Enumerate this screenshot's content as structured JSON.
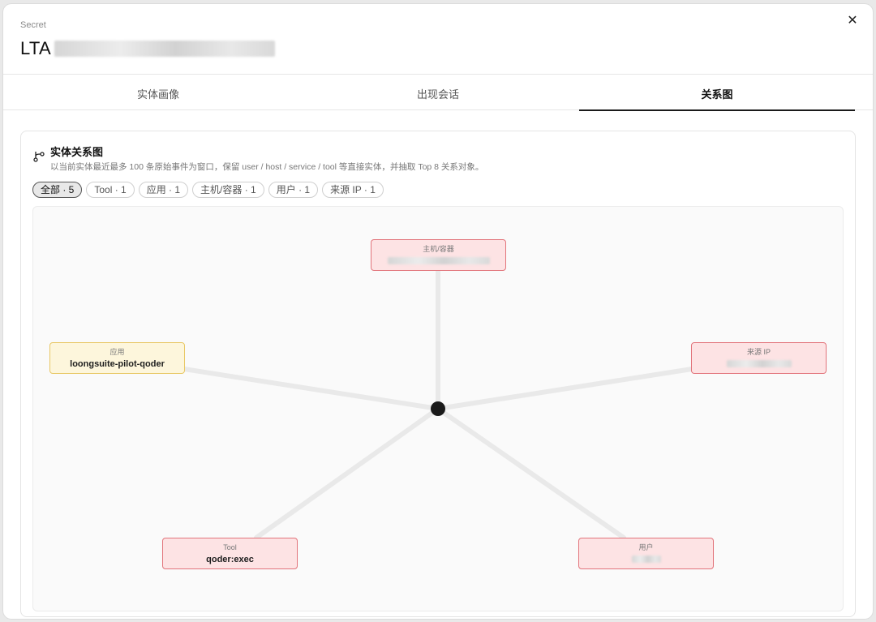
{
  "header": {
    "kicker": "Secret",
    "title_prefix": "LTA",
    "close_symbol": "✕"
  },
  "tabs": [
    {
      "label": "实体画像"
    },
    {
      "label": "出现会话"
    },
    {
      "label": "关系图"
    }
  ],
  "card": {
    "title": "实体关系图",
    "description": "以当前实体最近最多 100 条原始事件为窗口，保留 user / host / service / tool 等直接实体，并抽取 Top 8 关系对象。"
  },
  "filters": [
    {
      "label": "全部 · 5"
    },
    {
      "label": "Tool · 1"
    },
    {
      "label": "应用 · 1"
    },
    {
      "label": "主机/容器 · 1"
    },
    {
      "label": "用户 · 1"
    },
    {
      "label": "来源 IP · 1"
    }
  ],
  "nodes": {
    "host": {
      "type": "主机/容器"
    },
    "app": {
      "type": "应用",
      "label": "loongsuite-pilot-qoder"
    },
    "ip": {
      "type": "来源 IP"
    },
    "tool": {
      "type": "Tool",
      "label": "qoder:exec"
    },
    "user": {
      "type": "用户"
    }
  },
  "colors": {
    "edge": "#e9e9e9",
    "center": "#1a1a1a",
    "node_red_fill": "#fde3e4",
    "node_red_border": "#e2747b",
    "node_yellow_fill": "#fdf6dc",
    "node_yellow_border": "#e8c764"
  }
}
